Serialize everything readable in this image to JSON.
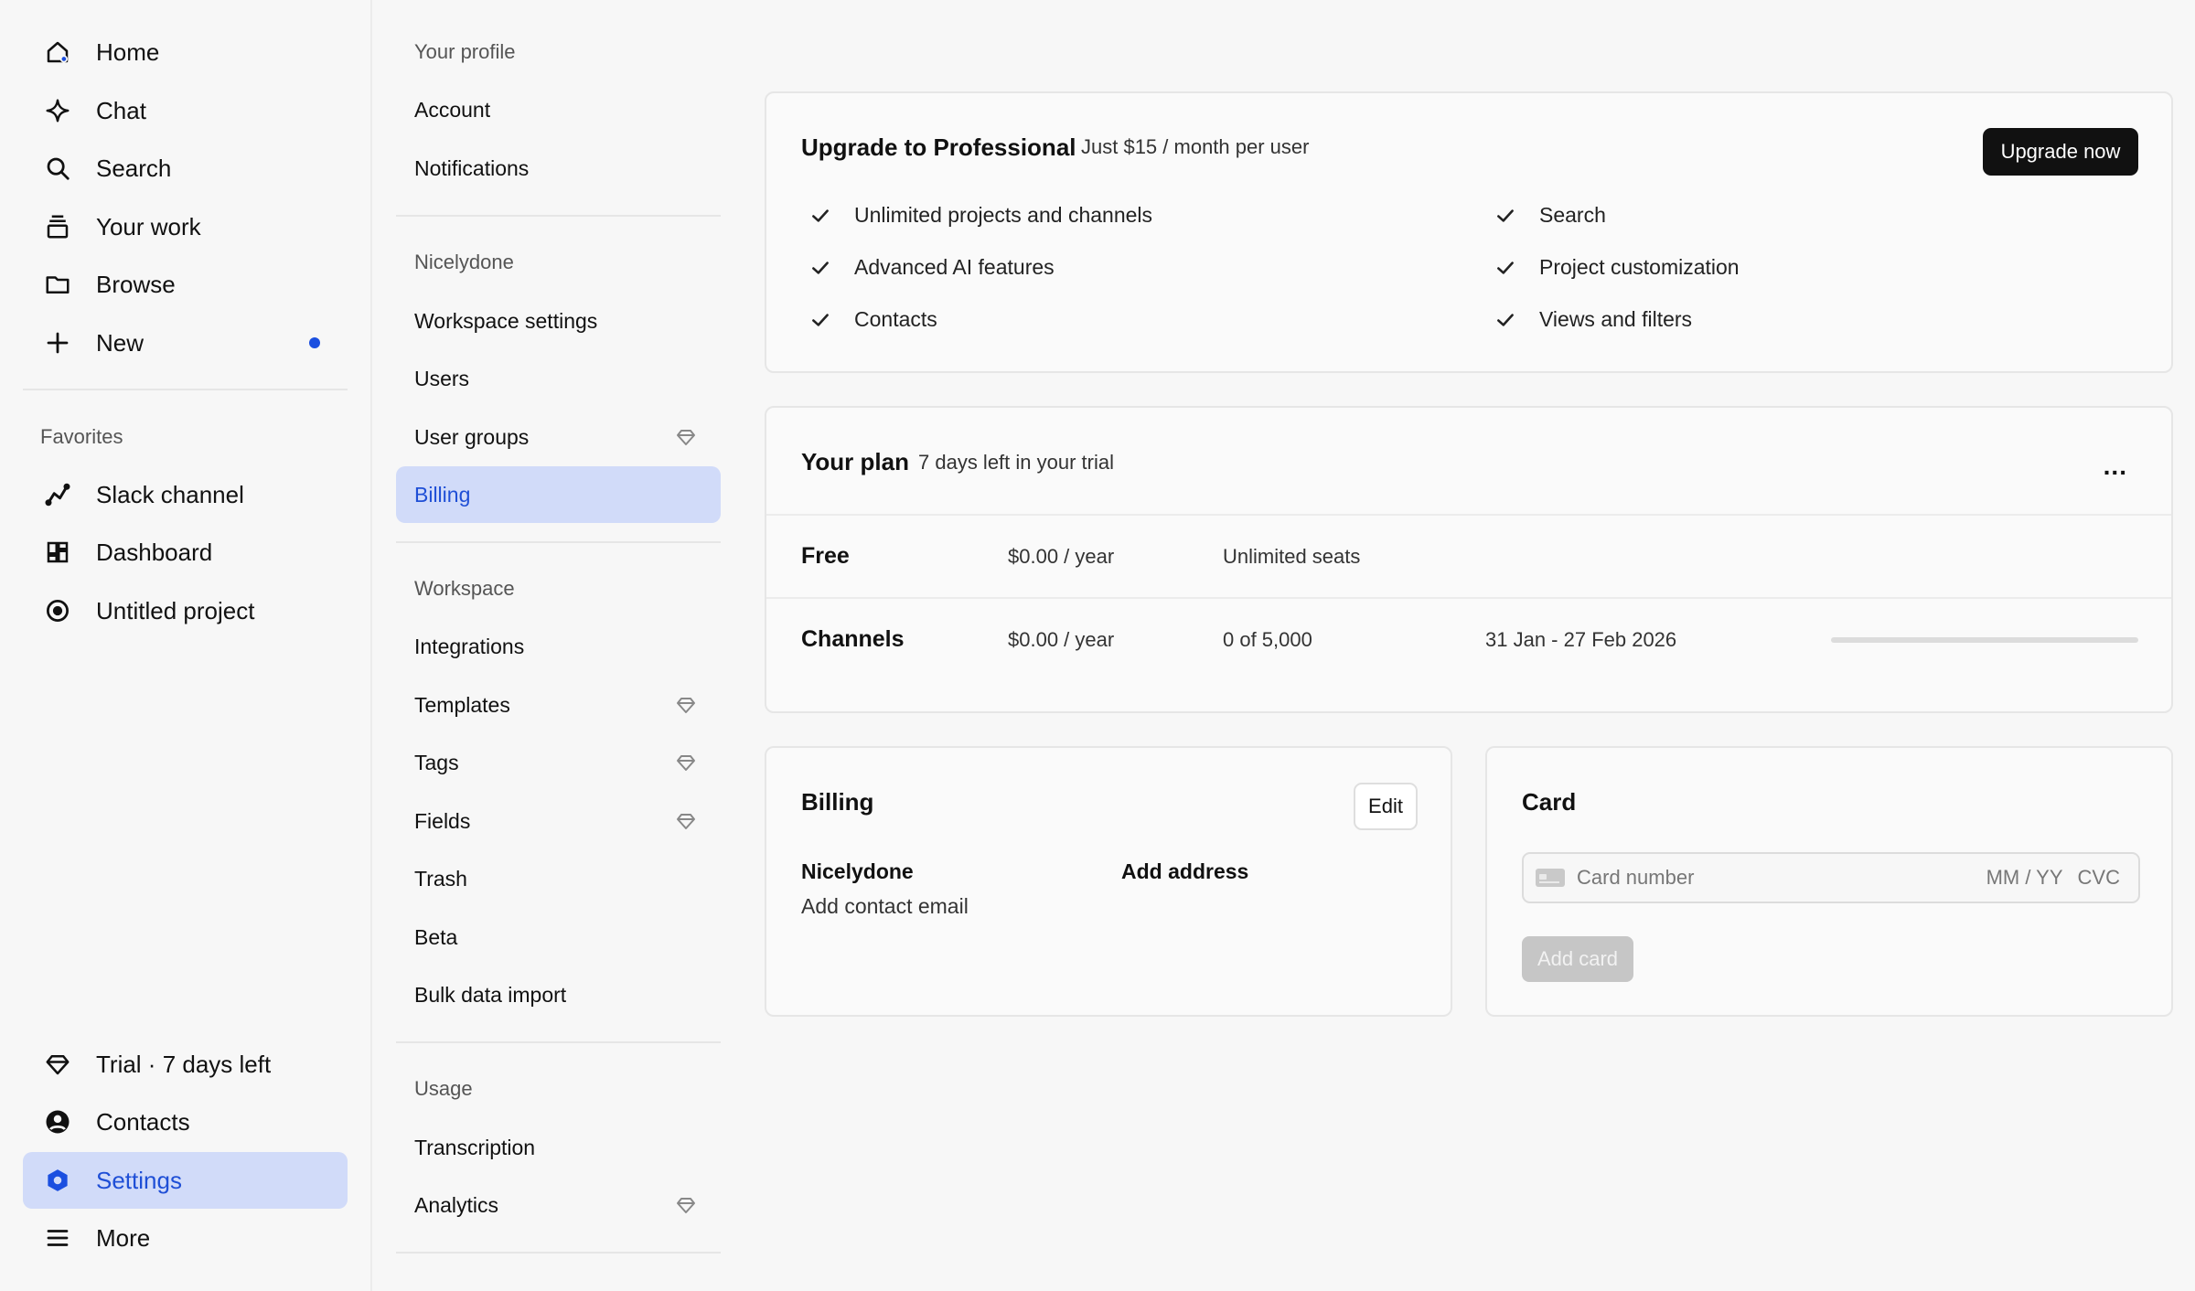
{
  "sidebar": {
    "main": [
      {
        "label": "Home",
        "icon": "home-icon"
      },
      {
        "label": "Chat",
        "icon": "sparkle-icon"
      },
      {
        "label": "Search",
        "icon": "search-icon"
      },
      {
        "label": "Your work",
        "icon": "stack-icon"
      },
      {
        "label": "Browse",
        "icon": "folder-icon"
      },
      {
        "label": "New",
        "icon": "plus-icon"
      }
    ],
    "favorites_label": "Favorites",
    "favorites": [
      {
        "label": "Slack channel",
        "icon": "chart-line-icon"
      },
      {
        "label": "Dashboard",
        "icon": "dashboard-icon"
      },
      {
        "label": "Untitled project",
        "icon": "compass-icon"
      }
    ],
    "bottom": [
      {
        "label": "Trial · 7 days left",
        "icon": "diamond-icon"
      },
      {
        "label": "Contacts",
        "icon": "user-circle-icon"
      },
      {
        "label": "Settings",
        "icon": "settings-hex-icon"
      },
      {
        "label": "More",
        "icon": "menu-icon"
      }
    ],
    "accent_color": "#1b4fe0",
    "active_bg": "#d1dbf9"
  },
  "settings_nav": {
    "profile_heading": "Your profile",
    "profile_items": [
      "Account",
      "Notifications"
    ],
    "org_heading": "Nicelydone",
    "org_items": [
      "Workspace settings",
      "Users",
      "User groups",
      "Billing"
    ],
    "workspace_heading": "Workspace",
    "workspace_items": [
      "Integrations",
      "Templates",
      "Tags",
      "Fields",
      "Trash",
      "Beta",
      "Bulk data import"
    ],
    "usage_heading": "Usage",
    "usage_items": [
      "Transcription",
      "Analytics"
    ]
  },
  "upgrade": {
    "title": "Upgrade to Professional",
    "subtitle": "Just $15 / month per user",
    "button": "Upgrade now",
    "features_left": [
      "Unlimited projects and channels",
      "Advanced AI features",
      "Contacts"
    ],
    "features_right": [
      "Search",
      "Project customization",
      "Views and filters"
    ]
  },
  "plan": {
    "title": "Your plan",
    "subtitle": "7 days left in your trial",
    "menu": "...",
    "rows": [
      {
        "name": "Free",
        "price": "$0.00 / year",
        "detail": "Unlimited seats",
        "period": ""
      },
      {
        "name": "Channels",
        "price": "$0.00 / year",
        "detail": "0 of 5,000",
        "period": "31 Jan - 27 Feb 2026",
        "progress": 0
      }
    ]
  },
  "billing": {
    "title": "Billing",
    "edit": "Edit",
    "org": "Nicelydone",
    "email": "Add contact email",
    "address": "Add address"
  },
  "card": {
    "title": "Card",
    "number_placeholder": "Card number",
    "expiry_placeholder": "MM / YY",
    "cvc_placeholder": "CVC",
    "button": "Add card"
  }
}
